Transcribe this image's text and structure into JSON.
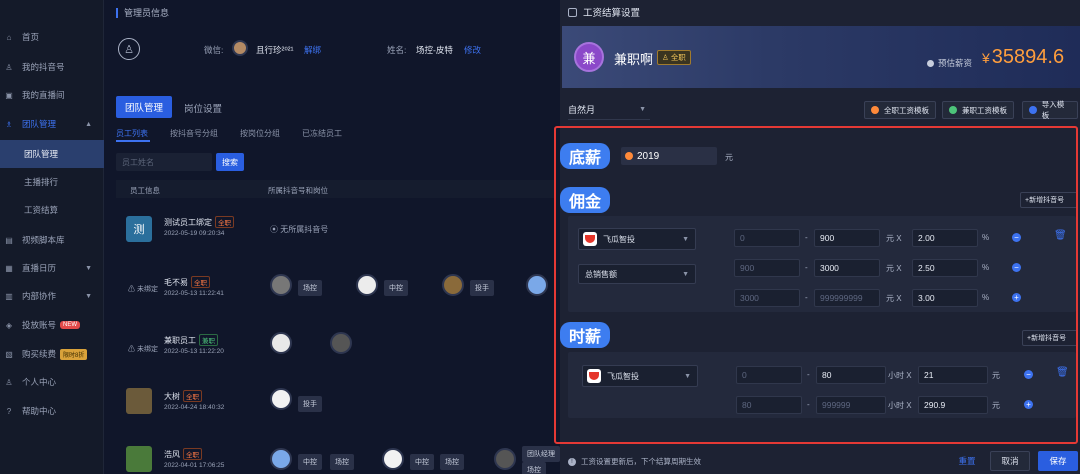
{
  "sidebar": {
    "items": [
      {
        "label": "首页"
      },
      {
        "label": "我的抖音号"
      },
      {
        "label": "我的直播间"
      },
      {
        "label": "团队管理"
      },
      {
        "label": "团队管理"
      },
      {
        "label": "主播排行"
      },
      {
        "label": "工资结算"
      },
      {
        "label": "视频脚本库"
      },
      {
        "label": "直播日历"
      },
      {
        "label": "内部协作"
      },
      {
        "label": "投放账号",
        "tag": "NEW"
      },
      {
        "label": "购买续费",
        "tag": "限时8折"
      },
      {
        "label": "个人中心"
      },
      {
        "label": "帮助中心"
      }
    ]
  },
  "main": {
    "section_title": "管理员信息",
    "wechat_label": "微信:",
    "wechat_name": "且行珍²⁰²¹",
    "wechat_unbind": "解绑",
    "name_label": "姓名:",
    "name_value": "场控-皮特",
    "name_edit": "修改",
    "tab_team": "团队管理",
    "tab_position": "岗位设置",
    "subtabs": [
      "员工列表",
      "按抖音号分组",
      "按岗位分组",
      "已冻结员工"
    ],
    "search_placeholder": "员工姓名",
    "search_button": "搜索",
    "col_employee": "员工信息",
    "col_accounts": "所属抖音号和岗位",
    "rows": [
      {
        "name": "测试员工绑定",
        "badge": "全职",
        "date": "2022-05-19 09:20:34",
        "note": "无所属抖音号",
        "avatar": "测"
      },
      {
        "name": "毛不易",
        "badge": "全职",
        "date": "2022-05-13 11:22:41",
        "status": "未绑定",
        "roles": [
          "场控",
          "中控",
          "投手"
        ]
      },
      {
        "name": "兼职员工",
        "badge": "兼职",
        "date": "2022-05-13 11:22:20",
        "status": "未绑定"
      },
      {
        "name": "大树",
        "badge": "全职",
        "date": "2022-04-24 18:40:32",
        "roles": [
          "投手"
        ]
      },
      {
        "name": "浩风",
        "badge": "全职",
        "date": "2022-04-01 17:06:25",
        "roles": [
          "中控",
          "场控",
          "中控",
          "场控",
          "团队经理",
          "场控"
        ]
      }
    ]
  },
  "dialog": {
    "title": "工资结算设置",
    "employee_initial": "兼",
    "employee_name": "兼职啊",
    "employee_tag": "全职",
    "estimate_label": "预估薪资",
    "currency": "¥",
    "estimate_amount": "35894.6",
    "period": "自然月",
    "btn_fulltime_tpl": "全职工资模板",
    "btn_parttime_tpl": "兼职工资模板",
    "btn_import_tpl": "导入模板",
    "base_salary_label": "底薪",
    "base_salary_value": "2019",
    "base_salary_unit": "元",
    "commission_label": "佣金",
    "add_account": "新增抖音号",
    "commission_platform": "飞瓜智投",
    "commission_metric": "总销售额",
    "commission_tiers": [
      {
        "from": "0",
        "to": "900",
        "rate": "2.00"
      },
      {
        "from": "900",
        "to": "3000",
        "rate": "2.50"
      },
      {
        "from": "3000",
        "to": "999999999",
        "rate": "3.00"
      }
    ],
    "hourly_label": "时薪",
    "hourly_platform": "飞瓜智投",
    "hourly_tiers": [
      {
        "from": "0",
        "to": "80",
        "pay": "21"
      },
      {
        "from": "80",
        "to": "999999",
        "pay": "290.9"
      }
    ],
    "unit_yuan": "元",
    "unit_hour": "小时",
    "mult": "X",
    "percent": "%",
    "dash": "-",
    "footer_note": "工资设置更新后，下个结算周期生效",
    "reset": "重置",
    "cancel": "取消",
    "save": "保存"
  }
}
